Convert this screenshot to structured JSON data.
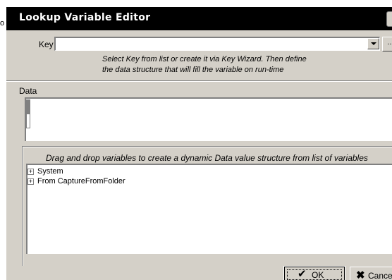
{
  "background": {
    "glyph": "o"
  },
  "dialog": {
    "title": "Lookup Variable Editor",
    "key_label": "Key",
    "key_value": "",
    "wizard_button_label": "...",
    "hint_line1": "Select Key from list or create it via Key Wizard. Then define",
    "hint_line2": "the data structure that will fill the variable on run-time",
    "data_label": "Data",
    "data_value": "",
    "tree_caption": "Drag and drop variables to create a dynamic Data value structure from list of variables",
    "tree_items": [
      {
        "label": "System",
        "expander": "+"
      },
      {
        "label": "From CaptureFromFolder",
        "expander": "+"
      }
    ],
    "ok_label": "OK",
    "cancel_label": "Cancel"
  },
  "icons": {
    "ok": "checkmark-icon",
    "cancel": "x-icon",
    "dropdown": "chevron-down-icon"
  },
  "colors": {
    "title_bar": "#000000",
    "title_text": "#ffffff",
    "dialog_face": "#d4d0c8",
    "field_bg": "#ffffff"
  }
}
